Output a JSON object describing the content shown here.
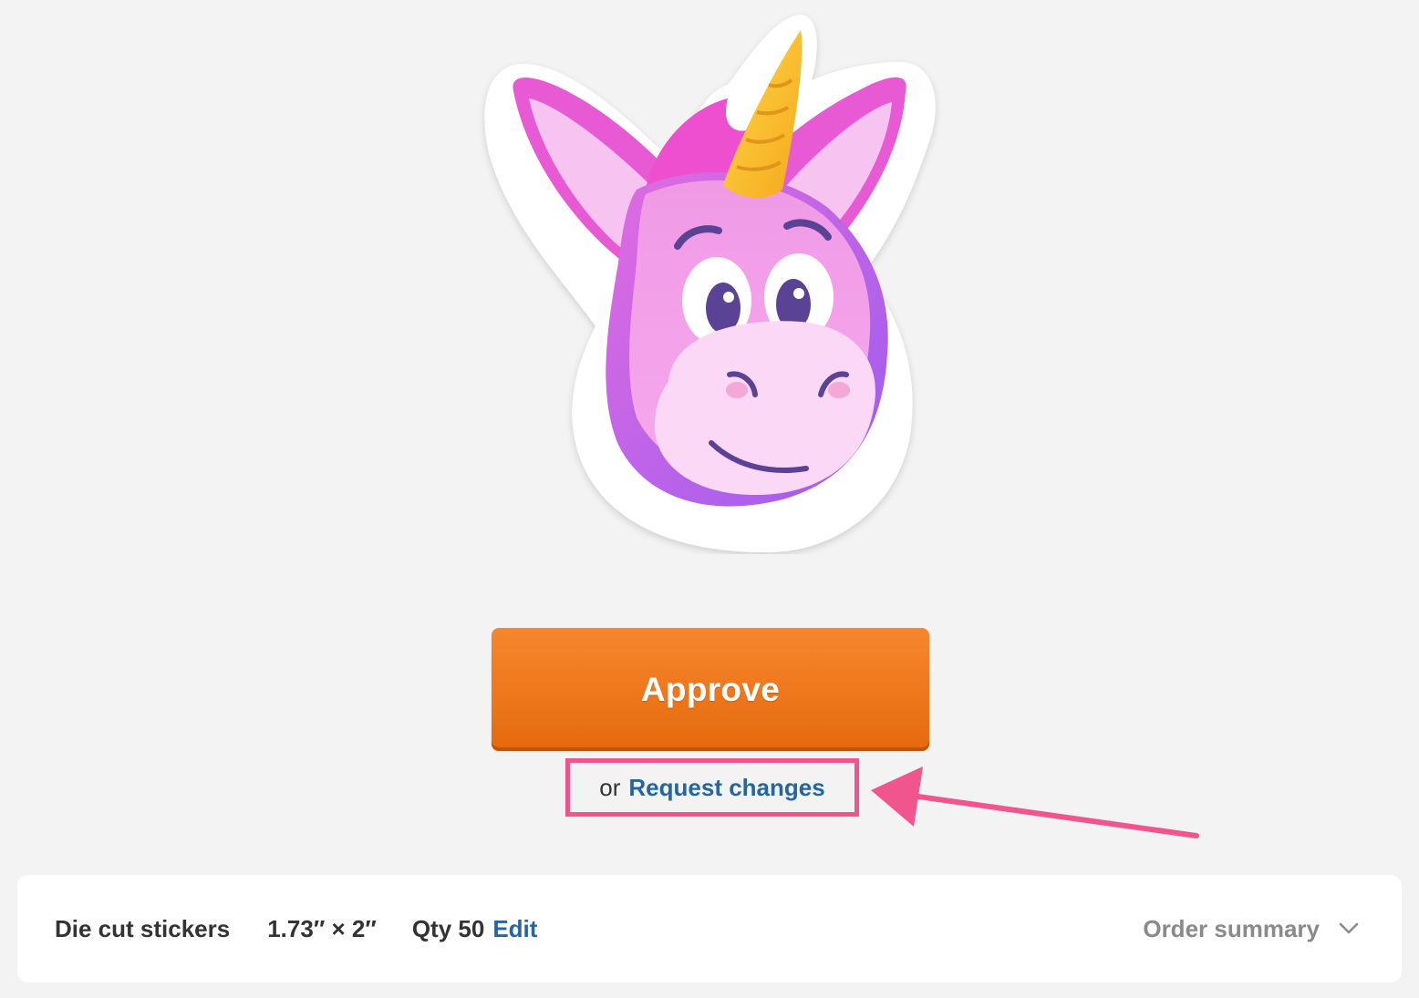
{
  "sticker": {
    "icon": "unicorn-sticker-image"
  },
  "approve": {
    "label": "Approve",
    "color": "#f07a1e"
  },
  "request": {
    "prefix": "or",
    "link_label": "Request changes",
    "highlight_color": "#f0558e"
  },
  "order": {
    "product": "Die cut stickers",
    "size": "1.73″ × 2″",
    "qty": "Qty 50",
    "edit_label": "Edit",
    "summary_label": "Order summary"
  }
}
